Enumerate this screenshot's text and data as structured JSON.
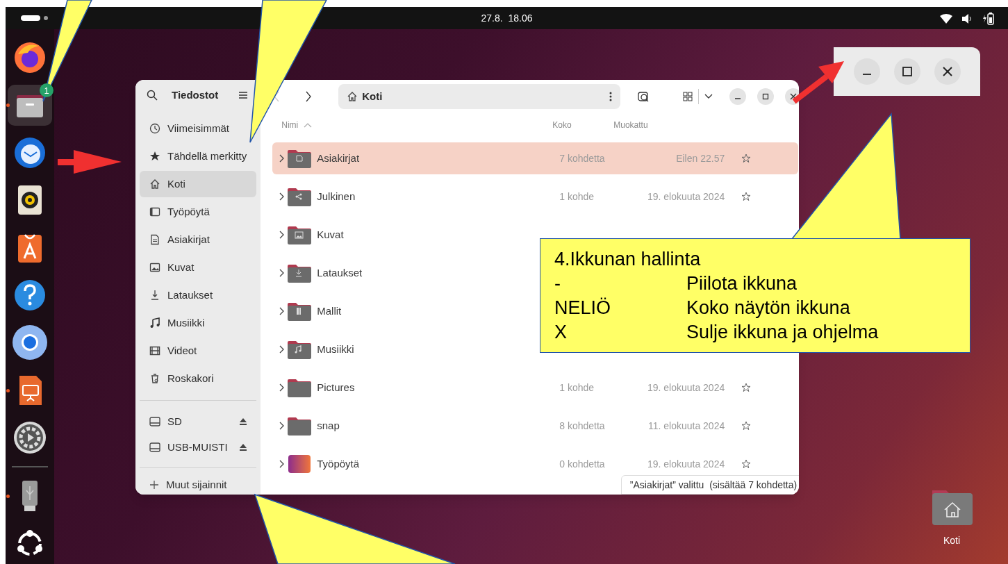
{
  "top_bar": {
    "clock": "27.8.  18.06"
  },
  "dock": [
    {
      "kind": "firefox",
      "selected": false
    },
    {
      "kind": "files",
      "selected": true,
      "running": true,
      "badge": "1"
    },
    {
      "kind": "mail",
      "selected": false
    },
    {
      "kind": "music",
      "selected": false
    },
    {
      "kind": "store",
      "selected": false
    },
    {
      "kind": "help",
      "selected": false
    },
    {
      "kind": "chromium",
      "selected": false
    },
    {
      "kind": "impress",
      "selected": false,
      "running": true
    },
    {
      "kind": "settings",
      "selected": false
    },
    {
      "kind": "usb",
      "selected": false,
      "running": true
    },
    {
      "kind": "apps",
      "selected": false
    }
  ],
  "files_window": {
    "title": "Tiedostot",
    "path": "Koti",
    "sidebar": {
      "places": [
        {
          "kind": "recent",
          "label": "Viimeisimmät",
          "selected": false
        },
        {
          "kind": "star",
          "label": "Tähdellä merkitty",
          "selected": false
        },
        {
          "kind": "home",
          "label": "Koti",
          "selected": true
        },
        {
          "kind": "desktop",
          "label": "Työpöytä",
          "selected": false
        },
        {
          "kind": "document",
          "label": "Asiakirjat",
          "selected": false
        },
        {
          "kind": "picture",
          "label": "Kuvat",
          "selected": false
        },
        {
          "kind": "download",
          "label": "Lataukset",
          "selected": false
        },
        {
          "kind": "music",
          "label": "Musiikki",
          "selected": false
        },
        {
          "kind": "video",
          "label": "Videot",
          "selected": false
        },
        {
          "kind": "trash",
          "label": "Roskakori",
          "selected": false
        }
      ],
      "devices": [
        {
          "label": "SD"
        },
        {
          "label": "USB-MUISTI"
        }
      ],
      "other": "Muut sijainnit"
    },
    "columns": [
      "Nimi",
      "Koko",
      "Muokattu"
    ],
    "rows": [
      {
        "kind": "document",
        "name": "Asiakirjat",
        "size": "7 kohdetta",
        "modified": "Eilen 22.57",
        "selected": true
      },
      {
        "kind": "share",
        "name": "Julkinen",
        "size": "1 kohde",
        "modified": "19. elokuuta 2024",
        "selected": false
      },
      {
        "kind": "picture",
        "name": "Kuvat",
        "selected": false
      },
      {
        "kind": "download",
        "name": "Lataukset",
        "selected": false
      },
      {
        "kind": "template",
        "name": "Mallit",
        "selected": false
      },
      {
        "kind": "music",
        "name": "Musiikki",
        "selected": false
      },
      {
        "kind": "plain",
        "name": "Pictures",
        "size": "1 kohde",
        "modified": "19. elokuuta 2024",
        "selected": false
      },
      {
        "kind": "plain",
        "name": "snap",
        "size": "8 kohdetta",
        "modified": "11. elokuuta 2024",
        "selected": false
      },
      {
        "kind": "desktop",
        "name": "Työpöytä",
        "size": "0 kohdetta",
        "modified": "19. elokuuta 2024",
        "selected": false
      }
    ],
    "status": "”Asiakirjat” valittu  (sisältää 7 kohdetta)"
  },
  "callout": {
    "title": "4.Ikkunan hallinta",
    "lines": [
      {
        "key": "-",
        "text": "Piilota ikkuna"
      },
      {
        "key": "NELIÖ",
        "text": "Koko näytön ikkuna"
      },
      {
        "key": "X",
        "text": "Sulje ikkuna ja ohjelma"
      }
    ]
  },
  "desktop_icons": [
    {
      "label": "Koti"
    }
  ]
}
